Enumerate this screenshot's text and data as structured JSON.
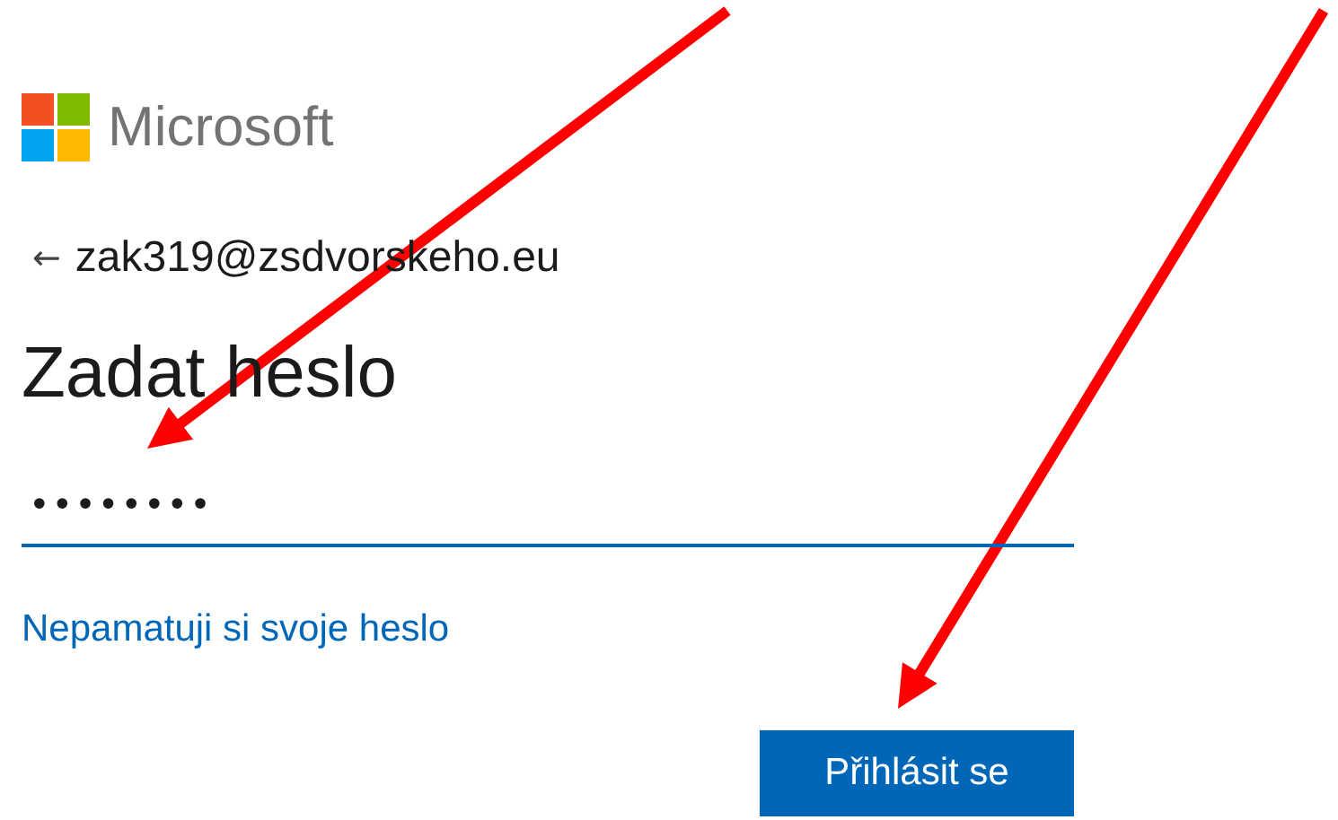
{
  "brand": {
    "name": "Microsoft"
  },
  "identity": {
    "back": "←",
    "email": "zak319@zsdvorskeho.eu"
  },
  "title": "Zadat heslo",
  "password_field": {
    "value": "••••••••"
  },
  "forgot_link": "Nepamatuji si svoje heslo",
  "sign_in_button": "Přihlásit se"
}
